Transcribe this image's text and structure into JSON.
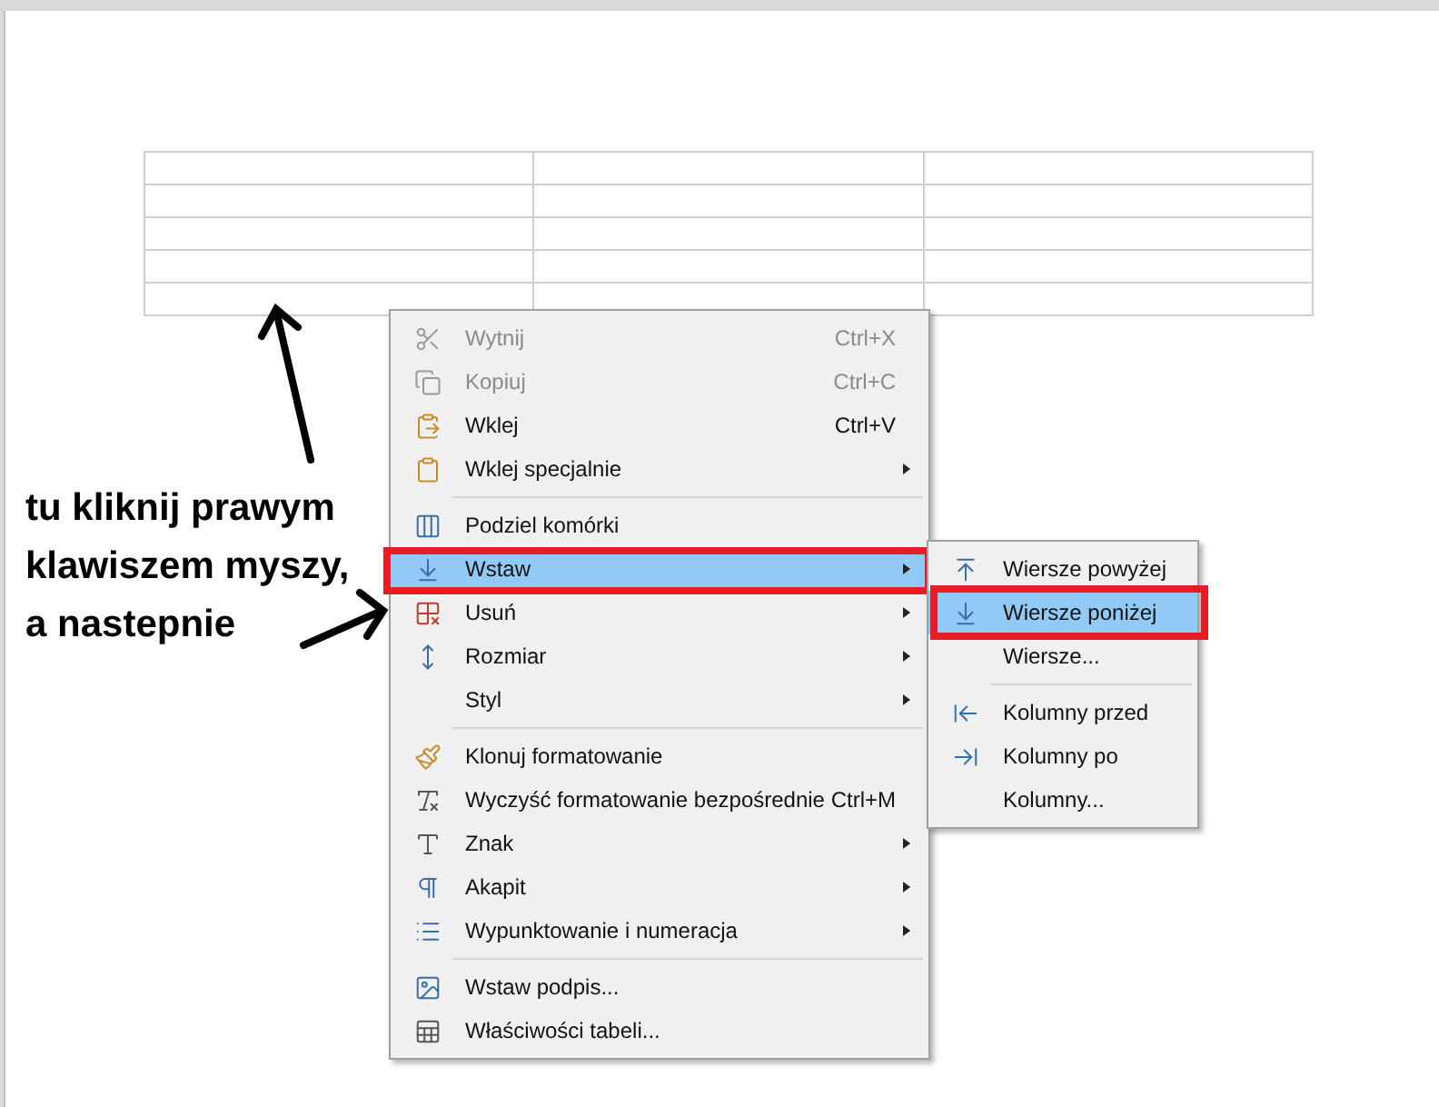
{
  "menu": {
    "groups": [
      [
        {
          "label": "Wytnij",
          "shortcut": "Ctrl+X",
          "disabled": true,
          "has_submenu": false,
          "selected": false,
          "outlined": false
        },
        {
          "label": "Kopiuj",
          "shortcut": "Ctrl+C",
          "disabled": true,
          "has_submenu": false,
          "selected": false,
          "outlined": false
        },
        {
          "label": "Wklej",
          "shortcut": "Ctrl+V",
          "disabled": false,
          "has_submenu": false,
          "selected": false,
          "outlined": false
        },
        {
          "label": "Wklej specjalnie",
          "disabled": false,
          "has_submenu": true,
          "selected": false,
          "outlined": false
        }
      ],
      [
        {
          "label": "Podziel komórki",
          "disabled": false,
          "has_submenu": false,
          "selected": false,
          "outlined": false
        },
        {
          "label": "Wstaw",
          "disabled": false,
          "has_submenu": true,
          "selected": true,
          "outlined": true
        },
        {
          "label": "Usuń",
          "disabled": false,
          "has_submenu": true,
          "selected": false,
          "outlined": false
        },
        {
          "label": "Rozmiar",
          "disabled": false,
          "has_submenu": true,
          "selected": false,
          "outlined": false
        },
        {
          "label": "Styl",
          "disabled": false,
          "has_submenu": true,
          "selected": false,
          "outlined": false
        }
      ],
      [
        {
          "label": "Klonuj formatowanie",
          "disabled": false,
          "has_submenu": false,
          "selected": false,
          "outlined": false
        },
        {
          "label": "Wyczyść formatowanie bezpośrednie",
          "shortcut": "Ctrl+M",
          "disabled": false,
          "has_submenu": false,
          "selected": false,
          "outlined": false
        },
        {
          "label": "Znak",
          "disabled": false,
          "has_submenu": true,
          "selected": false,
          "outlined": false
        },
        {
          "label": "Akapit",
          "disabled": false,
          "has_submenu": true,
          "selected": false,
          "outlined": false
        },
        {
          "label": "Wypunktowanie i numeracja",
          "disabled": false,
          "has_submenu": true,
          "selected": false,
          "outlined": false
        }
      ],
      [
        {
          "label": "Wstaw podpis...",
          "disabled": false,
          "has_submenu": false,
          "selected": false,
          "outlined": false
        },
        {
          "label": "Właściwości tabeli...",
          "disabled": false,
          "has_submenu": false,
          "selected": false,
          "outlined": false
        }
      ]
    ]
  },
  "submenu": {
    "groups": [
      [
        {
          "label": "Wiersze powyżej",
          "selected": false,
          "outlined": false
        },
        {
          "label": "Wiersze poniżej",
          "selected": true,
          "outlined": true
        },
        {
          "label": "Wiersze...",
          "selected": false,
          "outlined": false
        }
      ],
      [
        {
          "label": "Kolumny przed",
          "selected": false,
          "outlined": false
        },
        {
          "label": "Kolumny po",
          "selected": false,
          "outlined": false
        },
        {
          "label": "Kolumny...",
          "selected": false,
          "outlined": false
        }
      ]
    ]
  },
  "annotation": {
    "lines": [
      "tu kliknij prawym",
      "klawiszem myszy,",
      "a nastepnie"
    ]
  }
}
